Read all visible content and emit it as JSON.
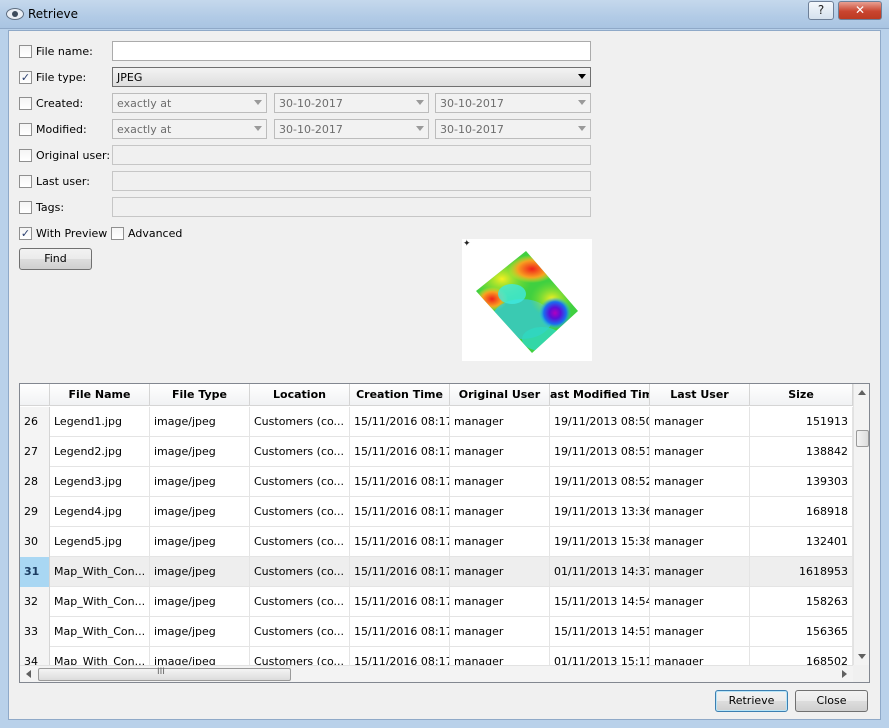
{
  "window": {
    "title": "Retrieve",
    "help_label": "?",
    "close_label": "✕"
  },
  "form": {
    "file_name": {
      "label": "File name:",
      "checked": false,
      "value": ""
    },
    "file_type": {
      "label": "File type:",
      "checked": true,
      "value": "JPEG"
    },
    "created": {
      "label": "Created:",
      "checked": false,
      "mode": "exactly at",
      "date1": "30-10-2017",
      "date2": "30-10-2017"
    },
    "modified": {
      "label": "Modified:",
      "checked": false,
      "mode": "exactly at",
      "date1": "30-10-2017",
      "date2": "30-10-2017"
    },
    "original_user": {
      "label": "Original user:",
      "checked": false,
      "value": ""
    },
    "last_user": {
      "label": "Last user:",
      "checked": false,
      "value": ""
    },
    "tags": {
      "label": "Tags:",
      "checked": false,
      "value": ""
    },
    "with_preview": {
      "label": "With Preview",
      "checked": true
    },
    "advanced": {
      "label": "Advanced",
      "checked": false
    },
    "find_label": "Find"
  },
  "table": {
    "columns": [
      "",
      "File Name",
      "File Type",
      "Location",
      "Creation Time",
      "Original User",
      "ast Modified Tim",
      "Last User",
      "Size"
    ],
    "rows": [
      {
        "idx": "26",
        "name": "Legend1.jpg",
        "type": "image/jpeg",
        "location": "Customers (co...",
        "created": "15/11/2016 08:17",
        "orig_user": "manager",
        "modified": "19/11/2013 08:50",
        "last_user": "manager",
        "size": "151913"
      },
      {
        "idx": "27",
        "name": "Legend2.jpg",
        "type": "image/jpeg",
        "location": "Customers (co...",
        "created": "15/11/2016 08:17",
        "orig_user": "manager",
        "modified": "19/11/2013 08:51",
        "last_user": "manager",
        "size": "138842"
      },
      {
        "idx": "28",
        "name": "Legend3.jpg",
        "type": "image/jpeg",
        "location": "Customers (co...",
        "created": "15/11/2016 08:17",
        "orig_user": "manager",
        "modified": "19/11/2013 08:52",
        "last_user": "manager",
        "size": "139303"
      },
      {
        "idx": "29",
        "name": "Legend4.jpg",
        "type": "image/jpeg",
        "location": "Customers (co...",
        "created": "15/11/2016 08:17",
        "orig_user": "manager",
        "modified": "19/11/2013 13:36",
        "last_user": "manager",
        "size": "168918"
      },
      {
        "idx": "30",
        "name": "Legend5.jpg",
        "type": "image/jpeg",
        "location": "Customers (co...",
        "created": "15/11/2016 08:17",
        "orig_user": "manager",
        "modified": "19/11/2013 15:38",
        "last_user": "manager",
        "size": "132401"
      },
      {
        "idx": "31",
        "name": "Map_With_Con...",
        "type": "image/jpeg",
        "location": "Customers (co...",
        "created": "15/11/2016 08:17",
        "orig_user": "manager",
        "modified": "01/11/2013 14:37",
        "last_user": "manager",
        "size": "1618953",
        "selected": true
      },
      {
        "idx": "32",
        "name": "Map_With_Con...",
        "type": "image/jpeg",
        "location": "Customers (co...",
        "created": "15/11/2016 08:17",
        "orig_user": "manager",
        "modified": "15/11/2013 14:54",
        "last_user": "manager",
        "size": "158263"
      },
      {
        "idx": "33",
        "name": "Map_With_Con...",
        "type": "image/jpeg",
        "location": "Customers (co...",
        "created": "15/11/2016 08:17",
        "orig_user": "manager",
        "modified": "15/11/2013 14:51",
        "last_user": "manager",
        "size": "156365"
      },
      {
        "idx": "34",
        "name": "Map_With_Con...",
        "type": "image/jpeg",
        "location": "Customers (co...",
        "created": "15/11/2016 08:17",
        "orig_user": "manager",
        "modified": "01/11/2013 15:11",
        "last_user": "manager",
        "size": "168502"
      }
    ],
    "hscroll_grip": "III"
  },
  "footer": {
    "retrieve_label": "Retrieve",
    "close_label": "Close"
  }
}
